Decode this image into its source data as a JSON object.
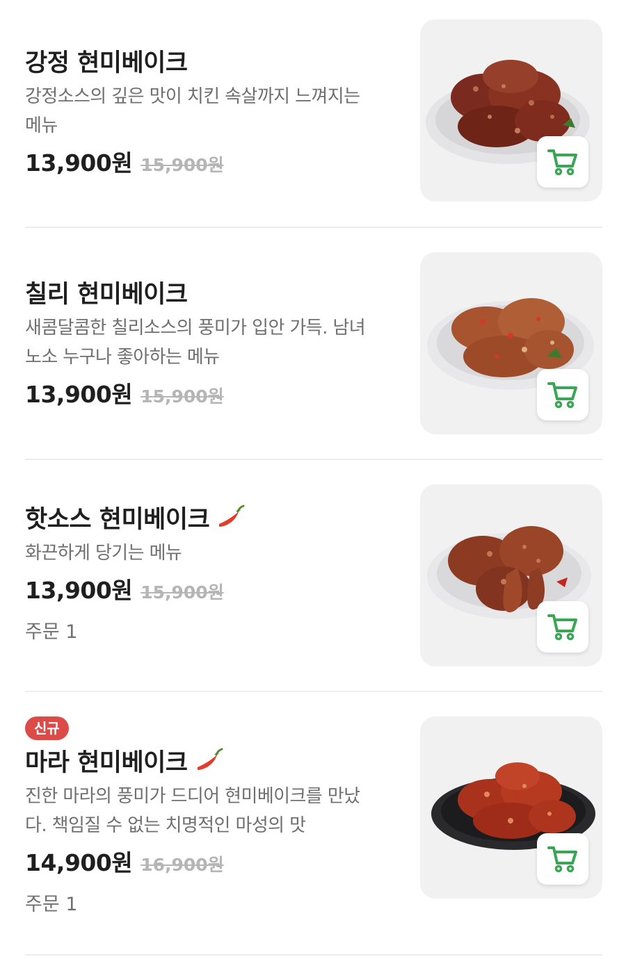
{
  "menu": {
    "items": [
      {
        "title": "강정 현미베이크",
        "desc_line1": "강정소스의 깊은 맛이 치킨 속살까지 느껴지는",
        "desc_line2": "메뉴",
        "price": "13,900원",
        "original_price": "15,900원"
      },
      {
        "title": "칠리 현미베이크",
        "desc_line1": "새콤달콤한 칠리소스의 풍미가 입안 가득. 남녀",
        "desc_line2": "노소 누구나 좋아하는 메뉴",
        "price": "13,900원",
        "original_price": "15,900원"
      },
      {
        "title": "핫소스 현미베이크",
        "spicy_icon": "chili-pepper-icon",
        "desc_line1": "화끈하게 당기는 메뉴",
        "price": "13,900원",
        "original_price": "15,900원",
        "order_text": "주문 1"
      },
      {
        "badge": "신규",
        "title": "마라 현미베이크",
        "spicy_icon": "chili-pepper-icon",
        "desc_line1": "진한 마라의 풍미가 드디어 현미베이크를 만났",
        "desc_line2": "다. 책임질 수 없는 치명적인 마성의 맛",
        "price": "14,900원",
        "original_price": "16,900원",
        "order_text": "주문 1"
      }
    ]
  },
  "icons": {
    "cart": "shopping-cart-icon"
  },
  "colors": {
    "cart_green": "#3aa655",
    "badge_red": "#dc4b47",
    "chili_red": "#e23c2c",
    "strike_gray": "#b5b5b5",
    "thumb_bg": "#f1f1f2"
  }
}
